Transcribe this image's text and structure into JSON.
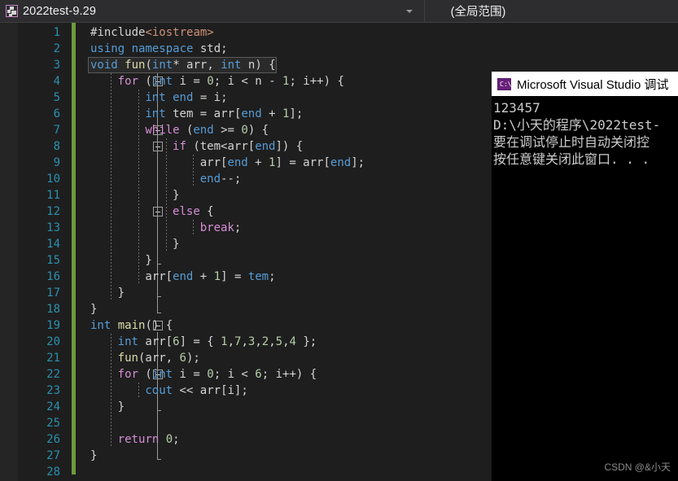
{
  "navbar": {
    "project_icon": "puzzle-piece-icon",
    "project_name": "2022test-9.29",
    "dropdown_icon": "chevron-down-icon",
    "scope": "(全局范围)"
  },
  "editor": {
    "accent_change_bar": "#6f9b3c",
    "background": "#1e1e1e",
    "line_number_color": "#2b91af",
    "first_line": 1,
    "last_line": 28,
    "lines": [
      {
        "n": 1,
        "indent": 0,
        "fold": false,
        "tokens": [
          {
            "t": "#include",
            "c": "pp"
          },
          {
            "t": "<iostream>",
            "c": "str"
          }
        ]
      },
      {
        "n": 2,
        "indent": 0,
        "fold": false,
        "tokens": [
          {
            "t": "using",
            "c": "ty"
          },
          {
            "t": " ",
            "c": "pl"
          },
          {
            "t": "namespace",
            "c": "ty"
          },
          {
            "t": " std;",
            "c": "pl"
          }
        ]
      },
      {
        "n": 3,
        "indent": 0,
        "fold": true,
        "tokens": [
          {
            "t": "void",
            "c": "ty"
          },
          {
            "t": " ",
            "c": "pl"
          },
          {
            "t": "fun",
            "c": "fn"
          },
          {
            "t": "(",
            "c": "pl"
          },
          {
            "t": "int",
            "c": "ty"
          },
          {
            "t": "* arr, ",
            "c": "pl"
          },
          {
            "t": "int",
            "c": "ty"
          },
          {
            "t": " n) {",
            "c": "pl"
          }
        ]
      },
      {
        "n": 4,
        "indent": 1,
        "fold": true,
        "tokens": [
          {
            "t": "for",
            "c": "kw"
          },
          {
            "t": " (",
            "c": "pl"
          },
          {
            "t": "int",
            "c": "ty"
          },
          {
            "t": " i = ",
            "c": "pl"
          },
          {
            "t": "0",
            "c": "num"
          },
          {
            "t": "; i < n - ",
            "c": "pl"
          },
          {
            "t": "1",
            "c": "num"
          },
          {
            "t": "; i++) {",
            "c": "pl"
          }
        ]
      },
      {
        "n": 5,
        "indent": 2,
        "fold": false,
        "tokens": [
          {
            "t": "int",
            "c": "ty"
          },
          {
            "t": " ",
            "c": "pl"
          },
          {
            "t": "end",
            "c": "ty"
          },
          {
            "t": " = i;",
            "c": "pl"
          }
        ]
      },
      {
        "n": 6,
        "indent": 2,
        "fold": false,
        "tokens": [
          {
            "t": "int",
            "c": "ty"
          },
          {
            "t": " tem = arr[",
            "c": "pl"
          },
          {
            "t": "end",
            "c": "ty"
          },
          {
            "t": " + ",
            "c": "pl"
          },
          {
            "t": "1",
            "c": "num"
          },
          {
            "t": "];",
            "c": "pl"
          }
        ]
      },
      {
        "n": 7,
        "indent": 2,
        "fold": true,
        "tokens": [
          {
            "t": "while",
            "c": "kw"
          },
          {
            "t": " (",
            "c": "pl"
          },
          {
            "t": "end",
            "c": "ty"
          },
          {
            "t": " >= ",
            "c": "pl"
          },
          {
            "t": "0",
            "c": "num"
          },
          {
            "t": ") {",
            "c": "pl"
          }
        ]
      },
      {
        "n": 8,
        "indent": 3,
        "fold": true,
        "tokens": [
          {
            "t": "if",
            "c": "kw"
          },
          {
            "t": " (tem<arr[",
            "c": "pl"
          },
          {
            "t": "end",
            "c": "ty"
          },
          {
            "t": "]) {",
            "c": "pl"
          }
        ]
      },
      {
        "n": 9,
        "indent": 4,
        "fold": false,
        "tokens": [
          {
            "t": "arr[",
            "c": "pl"
          },
          {
            "t": "end",
            "c": "ty"
          },
          {
            "t": " + ",
            "c": "pl"
          },
          {
            "t": "1",
            "c": "num"
          },
          {
            "t": "] = arr[",
            "c": "pl"
          },
          {
            "t": "end",
            "c": "ty"
          },
          {
            "t": "];",
            "c": "pl"
          }
        ]
      },
      {
        "n": 10,
        "indent": 4,
        "fold": false,
        "tokens": [
          {
            "t": "end",
            "c": "ty"
          },
          {
            "t": "--;",
            "c": "pl"
          }
        ]
      },
      {
        "n": 11,
        "indent": 3,
        "fold": false,
        "tokens": [
          {
            "t": "}",
            "c": "pl"
          }
        ]
      },
      {
        "n": 12,
        "indent": 3,
        "fold": true,
        "tokens": [
          {
            "t": "else",
            "c": "kw"
          },
          {
            "t": " {",
            "c": "pl"
          }
        ]
      },
      {
        "n": 13,
        "indent": 4,
        "fold": false,
        "tokens": [
          {
            "t": "break",
            "c": "kw"
          },
          {
            "t": ";",
            "c": "pl"
          }
        ]
      },
      {
        "n": 14,
        "indent": 3,
        "fold": false,
        "tokens": [
          {
            "t": "}",
            "c": "pl"
          }
        ]
      },
      {
        "n": 15,
        "indent": 2,
        "fold": false,
        "tokens": [
          {
            "t": "}",
            "c": "pl"
          }
        ]
      },
      {
        "n": 16,
        "indent": 2,
        "fold": false,
        "tokens": [
          {
            "t": "arr[",
            "c": "pl"
          },
          {
            "t": "end",
            "c": "ty"
          },
          {
            "t": " + ",
            "c": "pl"
          },
          {
            "t": "1",
            "c": "num"
          },
          {
            "t": "] = ",
            "c": "pl"
          },
          {
            "t": "tem",
            "c": "ty"
          },
          {
            "t": ";",
            "c": "pl"
          }
        ]
      },
      {
        "n": 17,
        "indent": 1,
        "fold": false,
        "tokens": [
          {
            "t": "}",
            "c": "pl"
          }
        ]
      },
      {
        "n": 18,
        "indent": 0,
        "fold": false,
        "tokens": [
          {
            "t": "}",
            "c": "pl"
          }
        ]
      },
      {
        "n": 19,
        "indent": 0,
        "fold": true,
        "tokens": [
          {
            "t": "int",
            "c": "ty"
          },
          {
            "t": " ",
            "c": "pl"
          },
          {
            "t": "main",
            "c": "fn"
          },
          {
            "t": "() {",
            "c": "pl"
          }
        ]
      },
      {
        "n": 20,
        "indent": 1,
        "fold": false,
        "tokens": [
          {
            "t": "int",
            "c": "ty"
          },
          {
            "t": " arr[",
            "c": "pl"
          },
          {
            "t": "6",
            "c": "num"
          },
          {
            "t": "] = { ",
            "c": "pl"
          },
          {
            "t": "1",
            "c": "num"
          },
          {
            "t": ",",
            "c": "pl"
          },
          {
            "t": "7",
            "c": "num"
          },
          {
            "t": ",",
            "c": "pl"
          },
          {
            "t": "3",
            "c": "num"
          },
          {
            "t": ",",
            "c": "pl"
          },
          {
            "t": "2",
            "c": "num"
          },
          {
            "t": ",",
            "c": "pl"
          },
          {
            "t": "5",
            "c": "num"
          },
          {
            "t": ",",
            "c": "pl"
          },
          {
            "t": "4",
            "c": "num"
          },
          {
            "t": " };",
            "c": "pl"
          }
        ]
      },
      {
        "n": 21,
        "indent": 1,
        "fold": false,
        "tokens": [
          {
            "t": "fun",
            "c": "fn"
          },
          {
            "t": "(arr, ",
            "c": "pl"
          },
          {
            "t": "6",
            "c": "num"
          },
          {
            "t": ");",
            "c": "pl"
          }
        ]
      },
      {
        "n": 22,
        "indent": 1,
        "fold": true,
        "tokens": [
          {
            "t": "for",
            "c": "kw"
          },
          {
            "t": " (",
            "c": "pl"
          },
          {
            "t": "int",
            "c": "ty"
          },
          {
            "t": " i = ",
            "c": "pl"
          },
          {
            "t": "0",
            "c": "num"
          },
          {
            "t": "; i < ",
            "c": "pl"
          },
          {
            "t": "6",
            "c": "num"
          },
          {
            "t": "; i++) {",
            "c": "pl"
          }
        ]
      },
      {
        "n": 23,
        "indent": 2,
        "fold": false,
        "tokens": [
          {
            "t": "cout",
            "c": "ty"
          },
          {
            "t": " << arr[i];",
            "c": "pl"
          }
        ]
      },
      {
        "n": 24,
        "indent": 1,
        "fold": false,
        "tokens": [
          {
            "t": "}",
            "c": "pl"
          }
        ]
      },
      {
        "n": 25,
        "indent": 1,
        "fold": false,
        "tokens": []
      },
      {
        "n": 26,
        "indent": 1,
        "fold": false,
        "tokens": [
          {
            "t": "return",
            "c": "kw"
          },
          {
            "t": " ",
            "c": "pl"
          },
          {
            "t": "0",
            "c": "num"
          },
          {
            "t": ";",
            "c": "pl"
          }
        ]
      },
      {
        "n": 27,
        "indent": 0,
        "fold": false,
        "tokens": [
          {
            "t": "}",
            "c": "pl"
          }
        ]
      },
      {
        "n": 28,
        "indent": 0,
        "fold": false,
        "tokens": []
      }
    ]
  },
  "console": {
    "icon": "console-window-icon",
    "icon_label": "C:\\",
    "title": "Microsoft Visual Studio 调试",
    "output": [
      "123457",
      "D:\\小天的程序\\2022test-",
      "要在调试停止时自动关闭控",
      "按任意键关闭此窗口. . ."
    ]
  },
  "watermark": "CSDN @&小天"
}
